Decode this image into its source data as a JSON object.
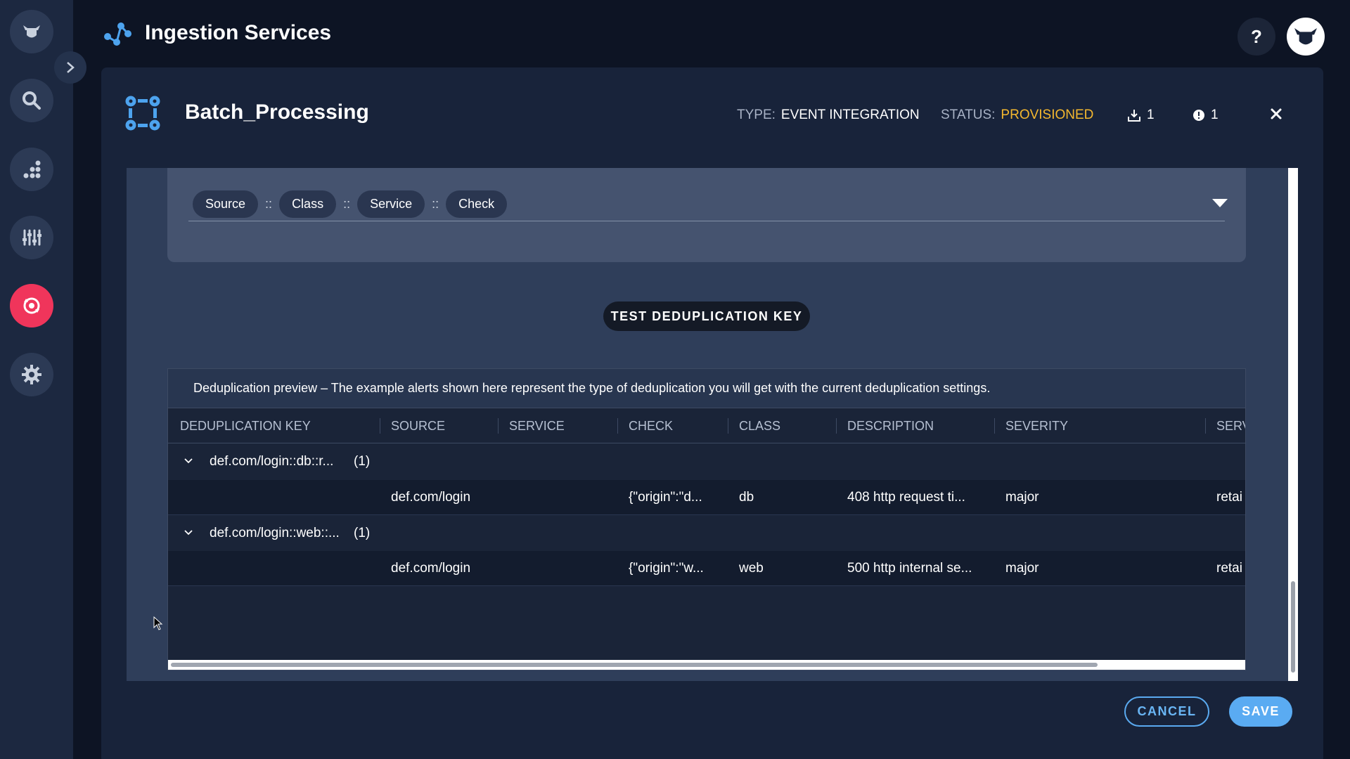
{
  "app": {
    "title": "Ingestion Services",
    "help_label": "?"
  },
  "sidebar": {
    "items": [
      {
        "icon": "bull-logo-icon"
      },
      {
        "icon": "search-icon"
      },
      {
        "icon": "analytics-icon"
      },
      {
        "icon": "sliders-icon"
      },
      {
        "icon": "integrations-icon",
        "active": true
      },
      {
        "icon": "gear-icon"
      }
    ],
    "active_color": "#f0355b"
  },
  "panel": {
    "title": "Batch_Processing",
    "type_label": "TYPE:",
    "type_value": "EVENT INTEGRATION",
    "status_label": "STATUS:",
    "status_value": "PROVISIONED",
    "status_color": "#f5b82e",
    "download_count": "1",
    "alert_count": "1"
  },
  "dedup_key": {
    "chips": [
      "Source",
      "Class",
      "Service",
      "Check"
    ],
    "separator": "::"
  },
  "test_button": "TEST DEDUPLICATION KEY",
  "preview": {
    "note": "Deduplication preview – The example alerts shown here represent the type of deduplication you will get with the current deduplication settings.",
    "columns": [
      "DEDUPLICATION KEY",
      "SOURCE",
      "SERVICE",
      "CHECK",
      "CLASS",
      "DESCRIPTION",
      "SEVERITY",
      "SERV"
    ],
    "groups": [
      {
        "key": "def.com/login::db::r...",
        "count": "(1)",
        "row": {
          "source": "def.com/login",
          "service": "",
          "check": "{\"origin\":\"d...",
          "class": "db",
          "description": "408 http request ti...",
          "severity": "major",
          "serv": "retai"
        }
      },
      {
        "key": "def.com/login::web::...",
        "count": "(1)",
        "row": {
          "source": "def.com/login",
          "service": "",
          "check": "{\"origin\":\"w...",
          "class": "web",
          "description": "500 http internal se...",
          "severity": "major",
          "serv": "retai"
        }
      }
    ]
  },
  "footer": {
    "cancel_label": "CANCEL",
    "save_label": "SAVE"
  }
}
